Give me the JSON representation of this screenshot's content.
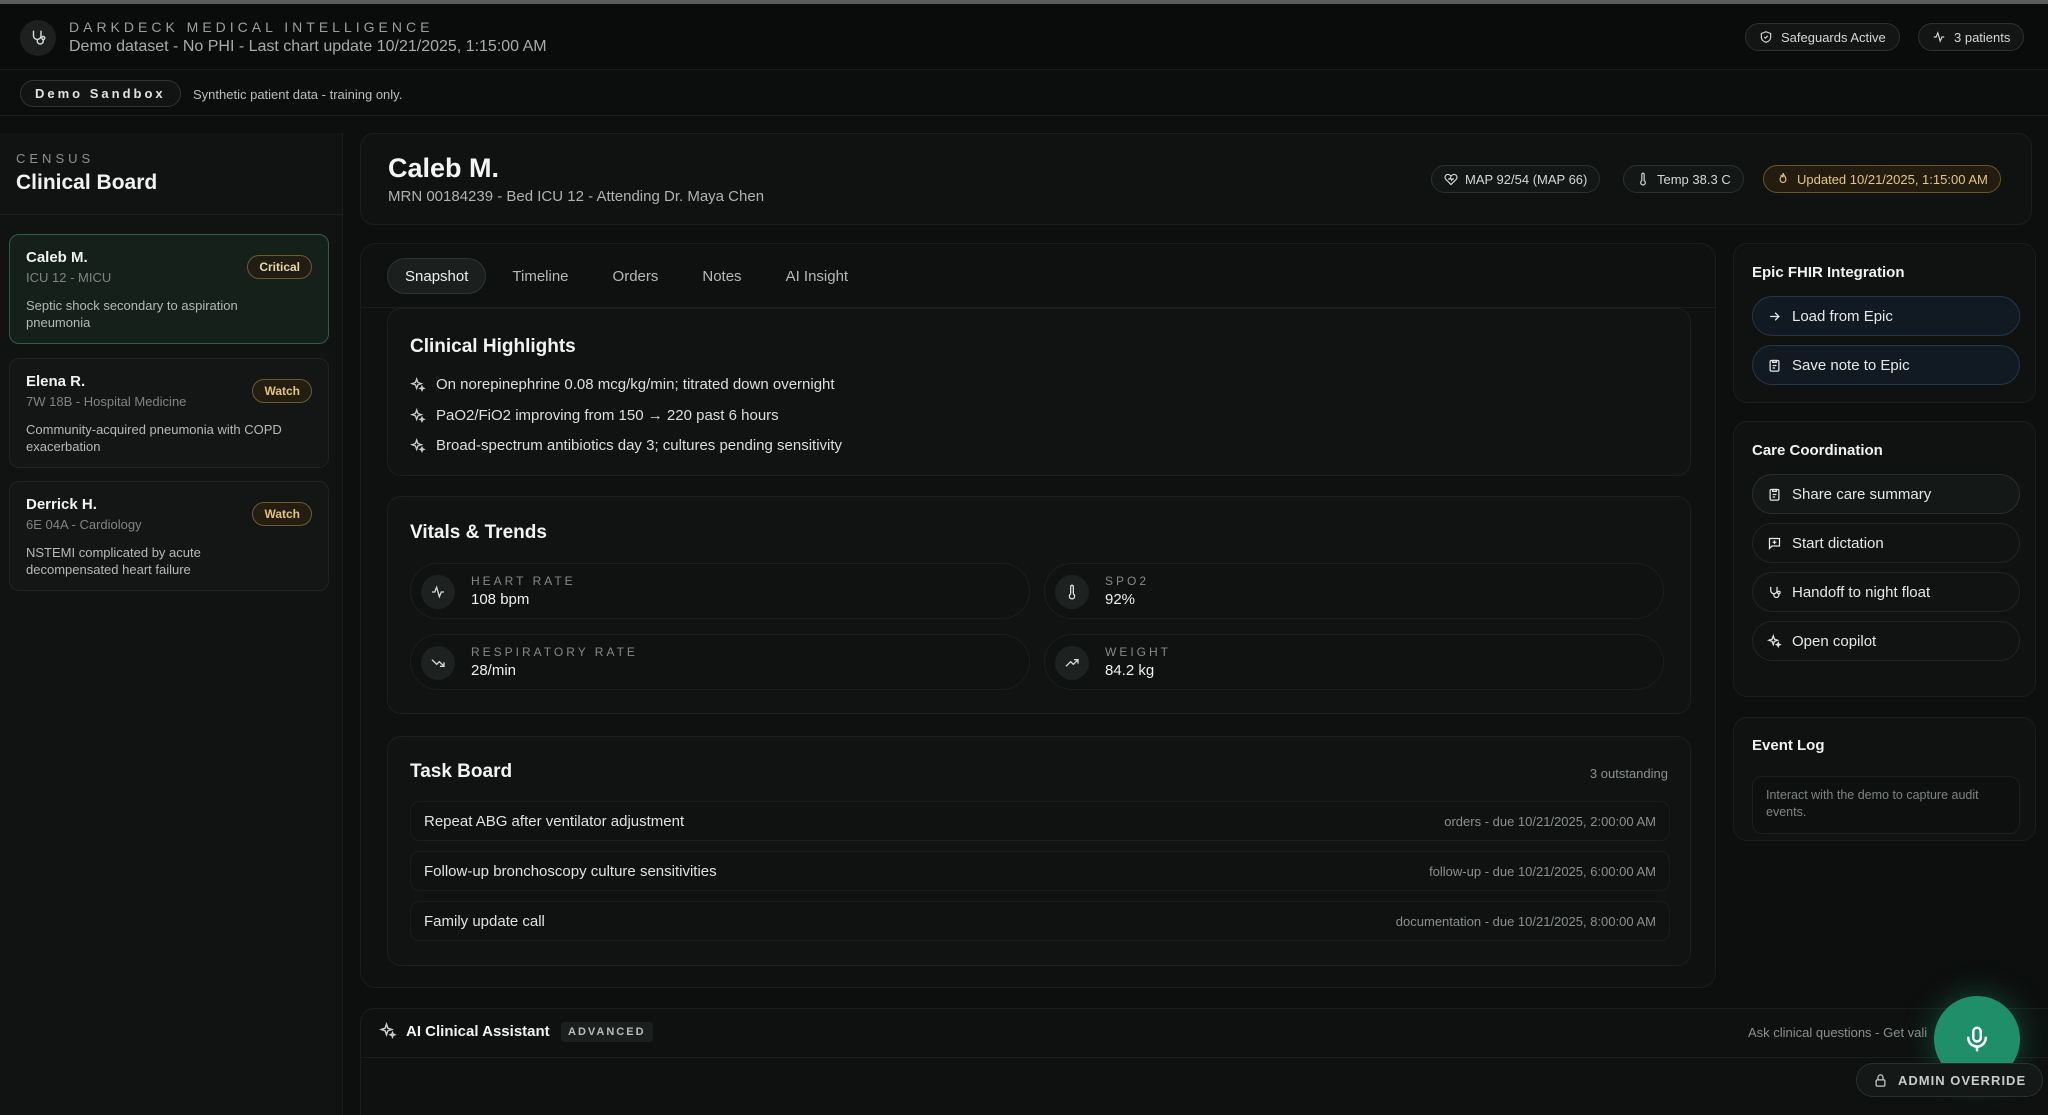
{
  "header": {
    "brand": "DARKDECK MEDICAL INTELLIGENCE",
    "subtitle": "Demo dataset - No PHI - Last chart update 10/21/2025, 1:15:00 AM",
    "safeguards": "Safeguards Active",
    "patients_count": "3 patients"
  },
  "sandbox": {
    "badge": "Demo Sandbox",
    "note": "Synthetic patient data - training only."
  },
  "sidebar": {
    "label": "CENSUS",
    "title": "Clinical Board",
    "patients": [
      {
        "name": "Caleb M.",
        "location": "ICU 12 - MICU",
        "badge": "Critical",
        "description": "Septic shock secondary to aspiration pneumonia"
      },
      {
        "name": "Elena R.",
        "location": "7W 18B - Hospital Medicine",
        "badge": "Watch",
        "description": "Community-acquired pneumonia with COPD exacerbation"
      },
      {
        "name": "Derrick H.",
        "location": "6E 04A - Cardiology",
        "badge": "Watch",
        "description": "NSTEMI complicated by acute decompensated heart failure"
      }
    ]
  },
  "patient": {
    "name": "Caleb M.",
    "mrn_line": "MRN 00184239 - Bed ICU 12 - Attending Dr. Maya Chen",
    "map": "MAP 92/54 (MAP 66)",
    "temp": "Temp 38.3 C",
    "updated": "Updated 10/21/2025, 1:15:00 AM"
  },
  "tabs": [
    "Snapshot",
    "Timeline",
    "Orders",
    "Notes",
    "AI Insight"
  ],
  "highlights": {
    "title": "Clinical Highlights",
    "items": [
      "On norepinephrine 0.08 mcg/kg/min; titrated down overnight",
      "PaO2/FiO2 improving from 150 → 220 past 6 hours",
      "Broad-spectrum antibiotics day 3; cultures pending sensitivity"
    ]
  },
  "vitals": {
    "title": "Vitals & Trends",
    "items": [
      {
        "label": "HEART RATE",
        "value": "108 bpm",
        "icon": "activity-icon"
      },
      {
        "label": "SPO2",
        "value": "92%",
        "icon": "thermometer-icon"
      },
      {
        "label": "RESPIRATORY RATE",
        "value": "28/min",
        "icon": "trend-down-icon"
      },
      {
        "label": "WEIGHT",
        "value": "84.2 kg",
        "icon": "trend-up-icon"
      }
    ]
  },
  "tasks": {
    "title": "Task Board",
    "count": "3 outstanding",
    "items": [
      {
        "title": "Repeat ABG after ventilator adjustment",
        "meta": "orders - due 10/21/2025, 2:00:00 AM"
      },
      {
        "title": "Follow-up bronchoscopy culture sensitivities",
        "meta": "follow-up - due 10/21/2025, 6:00:00 AM"
      },
      {
        "title": "Family update call",
        "meta": "documentation - due 10/21/2025, 8:00:00 AM"
      }
    ]
  },
  "epic": {
    "title": "Epic FHIR Integration",
    "load": "Load from Epic",
    "save": "Save note to Epic"
  },
  "care": {
    "title": "Care Coordination",
    "share": "Share care summary",
    "dictation": "Start dictation",
    "handoff": "Handoff to night float",
    "copilot": "Open copilot"
  },
  "event_log": {
    "title": "Event Log",
    "note": "Interact with the demo to capture audit events."
  },
  "assistant": {
    "title": "AI Clinical Assistant",
    "badge": "ADVANCED",
    "hint": "Ask clinical questions - Get vali"
  },
  "admin_override": "ADMIN OVERRIDE",
  "colors": {
    "accent": "#1f8f6a",
    "warning": "#e5c586",
    "background": "#0d0f0f"
  }
}
